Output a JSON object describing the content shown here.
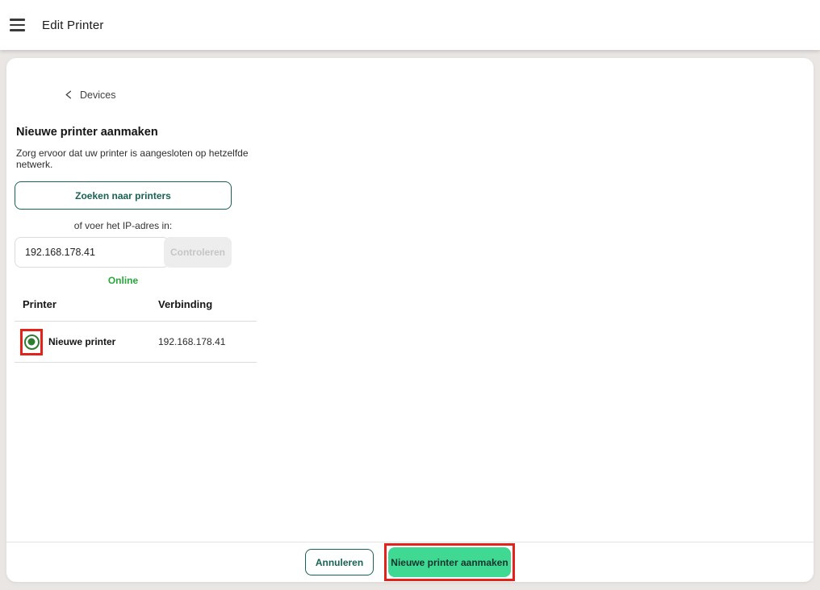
{
  "topbar": {
    "title": "Edit Printer"
  },
  "back_link": {
    "label": "Devices"
  },
  "form": {
    "heading": "Nieuwe printer aanmaken",
    "subtitle": "Zorg ervoor dat uw printer is aangesloten op hetzelfde netwerk.",
    "search_button_label": "Zoeken naar printers",
    "ip_prompt": "of voer het IP-adres in:",
    "ip_value": "192.168.178.41",
    "check_button_label": "Controleren",
    "status": "Online"
  },
  "table": {
    "headers": {
      "printer": "Printer",
      "connection": "Verbinding"
    },
    "rows": [
      {
        "name": "Nieuwe printer",
        "connection": "192.168.178.41",
        "selected": true
      }
    ]
  },
  "footer": {
    "cancel_label": "Annuleren",
    "submit_label": "Nieuwe printer aanmaken"
  },
  "colors": {
    "accent_dark_green": "#186352",
    "primary_button_green": "#40d994",
    "status_green": "#27a83b",
    "radio_green": "#2e7d32",
    "annotation_red": "#e32219",
    "background_gray": "#e9e6e4",
    "disabled_gray": "#ededed"
  }
}
